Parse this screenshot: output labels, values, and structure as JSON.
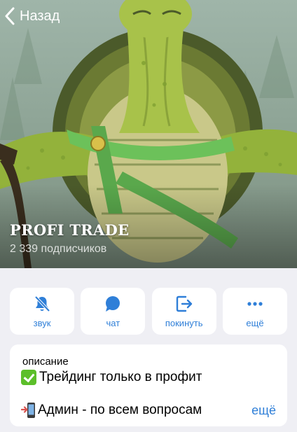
{
  "nav": {
    "back_label": "Назад"
  },
  "channel": {
    "title": "PROFI TRADE",
    "subscribers": "2 339 подписчиков"
  },
  "actions": [
    {
      "label": "звук",
      "icon": "bell-slash-icon"
    },
    {
      "label": "чат",
      "icon": "chat-bubble-icon"
    },
    {
      "label": "покинуть",
      "icon": "leave-icon"
    },
    {
      "label": "ещё",
      "icon": "more-dots-icon"
    }
  ],
  "description": {
    "caption": "описание",
    "line1": "Трейдинг только в профит",
    "line1_icon": "check-mark-icon",
    "line2": "Админ - по всем вопросам",
    "line2_icon": "mobile-arrow-icon",
    "more_label": "ещё"
  },
  "colors": {
    "accent": "#2f7fd8",
    "background": "#efeff4"
  }
}
